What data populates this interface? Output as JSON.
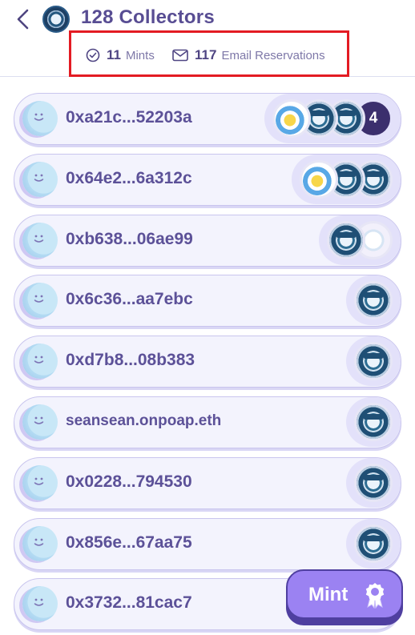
{
  "header": {
    "title": "128 Collectors"
  },
  "stats": {
    "mints_count": "11",
    "mints_label": "Mints",
    "email_count": "117",
    "email_label": "Email Reservations"
  },
  "collectors": [
    {
      "address": "0xa21c...52203a",
      "badges": [
        "bird",
        "attendee",
        "attendee"
      ],
      "more_count": "4"
    },
    {
      "address": "0x64e2...6a312c",
      "badges": [
        "bird",
        "attendee",
        "attendee"
      ]
    },
    {
      "address": "0xb638...06ae99",
      "badges": [
        "attendee",
        "white"
      ]
    },
    {
      "address": "0x6c36...aa7ebc",
      "badges": [
        "attendee"
      ]
    },
    {
      "address": "0xd7b8...08b383",
      "badges": [
        "attendee"
      ]
    },
    {
      "address": "seansean.onpoap.eth",
      "badges": [
        "attendee"
      ]
    },
    {
      "address": "0x0228...794530",
      "badges": [
        "attendee"
      ]
    },
    {
      "address": "0x856e...67aa75",
      "badges": [
        "attendee"
      ]
    },
    {
      "address": "0x3732...81cac7",
      "badges": []
    }
  ],
  "mint_button": {
    "label": "Mint",
    "icon": "ribbon-badge-icon"
  },
  "colors": {
    "accent": "#9b82f2",
    "highlight_border": "#e31b23",
    "text": "#5c5198"
  }
}
